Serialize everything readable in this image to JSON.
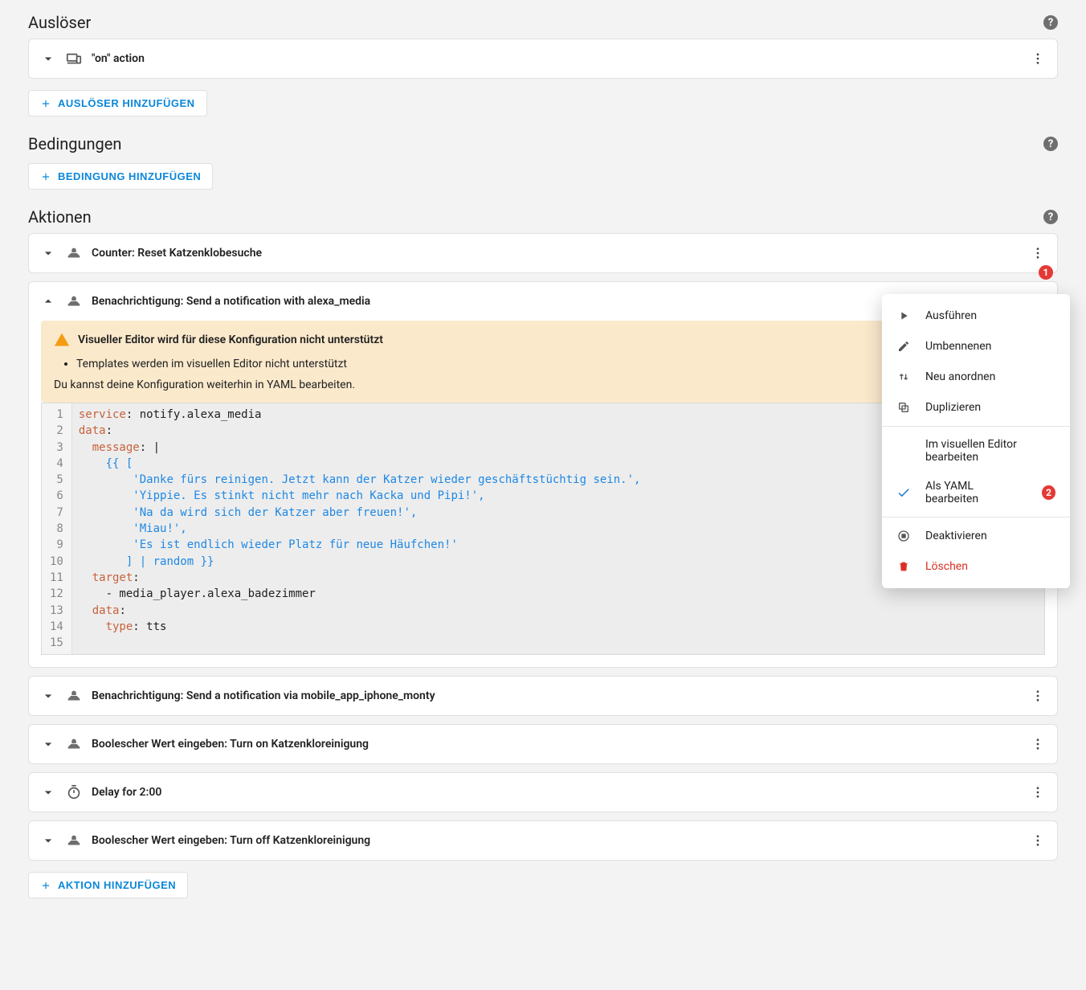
{
  "sections": {
    "triggers": {
      "title": "Auslöser",
      "add_label": "Auslöser hinzufügen",
      "items": [
        {
          "label": "\"on\" action"
        }
      ]
    },
    "conditions": {
      "title": "Bedingungen",
      "add_label": "Bedingung hinzufügen"
    },
    "actions": {
      "title": "Aktionen",
      "add_label": "Aktion hinzufügen",
      "items": [
        {
          "label": "Counter: Reset Katzenklobesuche"
        },
        {
          "label": "Benachrichtigung: Send a notification with alexa_media",
          "expanded": true,
          "badge": "1",
          "warning": {
            "title": "Visueller Editor wird für diese Konfiguration nicht unterstützt",
            "bullet": "Templates werden im visuellen Editor nicht unterstützt",
            "note": "Du kannst deine Konfiguration weiterhin in YAML bearbeiten."
          },
          "code_lines": [
            [
              [
                "key",
                "service"
              ],
              [
                "col",
                ": "
              ],
              [
                "pl",
                "notify.alexa_media"
              ]
            ],
            [
              [
                "key",
                "data"
              ],
              [
                "col",
                ":"
              ]
            ],
            [
              [
                "pl",
                "  "
              ],
              [
                "key",
                "message"
              ],
              [
                "col",
                ": "
              ],
              [
                "pl",
                "|"
              ]
            ],
            [
              [
                "pl",
                "    "
              ],
              [
                "str",
                "{{ ["
              ]
            ],
            [
              [
                "pl",
                "        "
              ],
              [
                "str",
                "'Danke fürs reinigen. Jetzt kann der Katzer wieder geschäftstüchtig sein.',"
              ]
            ],
            [
              [
                "pl",
                "        "
              ],
              [
                "str",
                "'Yippie. Es stinkt nicht mehr nach Kacka und Pipi!',"
              ]
            ],
            [
              [
                "pl",
                "        "
              ],
              [
                "str",
                "'Na da wird sich der Katzer aber freuen!',"
              ]
            ],
            [
              [
                "pl",
                "        "
              ],
              [
                "str",
                "'Miau!',"
              ]
            ],
            [
              [
                "pl",
                "        "
              ],
              [
                "str",
                "'Es ist endlich wieder Platz für neue Häufchen!'"
              ]
            ],
            [
              [
                "pl",
                "       "
              ],
              [
                "str",
                "] | random }}"
              ]
            ],
            [
              [
                "pl",
                "  "
              ],
              [
                "key",
                "target"
              ],
              [
                "col",
                ":"
              ]
            ],
            [
              [
                "pl",
                "    - media_player.alexa_badezimmer"
              ]
            ],
            [
              [
                "pl",
                "  "
              ],
              [
                "key",
                "data"
              ],
              [
                "col",
                ":"
              ]
            ],
            [
              [
                "pl",
                "    "
              ],
              [
                "key",
                "type"
              ],
              [
                "col",
                ": "
              ],
              [
                "pl",
                "tts"
              ]
            ],
            [
              [
                "pl",
                ""
              ]
            ]
          ]
        },
        {
          "label": "Benachrichtigung: Send a notification via mobile_app_iphone_monty"
        },
        {
          "label": "Boolescher Wert eingeben: Turn on Katzenkloreinigung"
        },
        {
          "label": "Delay for 2:00",
          "icon": "timer"
        },
        {
          "label": "Boolescher Wert eingeben: Turn off Katzenkloreinigung"
        }
      ]
    }
  },
  "menu": {
    "run": "Ausführen",
    "rename": "Umbennenen",
    "reorder": "Neu anordnen",
    "duplicate": "Duplizieren",
    "edit_visual": "Im visuellen Editor bearbeiten",
    "edit_yaml": "Als YAML bearbeiten",
    "yaml_badge": "2",
    "disable": "Deaktivieren",
    "delete": "Löschen"
  }
}
